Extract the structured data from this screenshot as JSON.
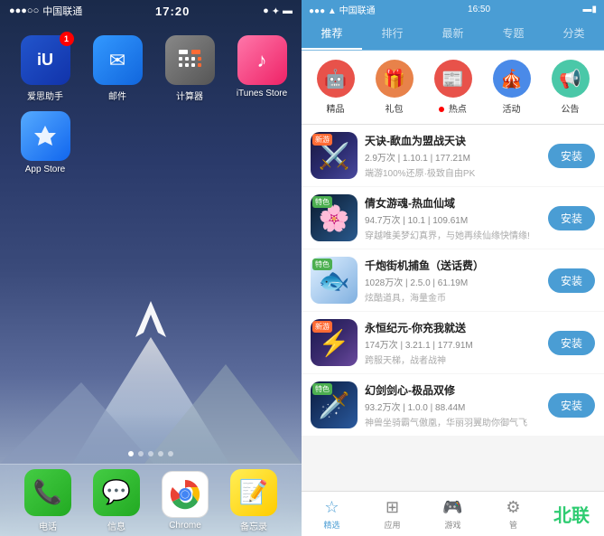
{
  "leftPanel": {
    "statusBar": {
      "carrier": "中国联通",
      "time": "17:20",
      "rightIcons": "● ▲ ✦ 🔋"
    },
    "apps": [
      {
        "id": "aisi",
        "label": "爱思助手",
        "badge": "1",
        "iconClass": "icon-aisi",
        "iconText": "iU"
      },
      {
        "id": "mail",
        "label": "邮件",
        "badge": "",
        "iconClass": "icon-mail",
        "iconText": "✉"
      },
      {
        "id": "calc",
        "label": "计算器",
        "badge": "",
        "iconClass": "icon-calc",
        "iconText": "⊞"
      },
      {
        "id": "itunes",
        "label": "iTunes Store",
        "badge": "",
        "iconClass": "icon-itunes",
        "iconText": "♪"
      },
      {
        "id": "appstore",
        "label": "App Store",
        "badge": "",
        "iconClass": "icon-appstore",
        "iconText": "A"
      }
    ],
    "dock": [
      {
        "id": "phone",
        "label": "电话",
        "iconClass": "icon-phone",
        "iconText": "📞"
      },
      {
        "id": "message",
        "label": "信息",
        "iconClass": "icon-message",
        "iconText": "💬"
      },
      {
        "id": "chrome",
        "label": "Chrome",
        "iconClass": "icon-chrome",
        "iconText": "⊕"
      },
      {
        "id": "notes",
        "label": "备忘录",
        "iconClass": "icon-notes",
        "iconText": "📝"
      }
    ]
  },
  "rightPanel": {
    "statusBar": {
      "carrier": "中国联通",
      "signal": "▲▲▲",
      "time": "16:50",
      "rightIcons": "🔋"
    },
    "tabs": [
      {
        "id": "featured",
        "label": "推荐",
        "active": true
      },
      {
        "id": "ranking",
        "label": "排行",
        "active": false
      },
      {
        "id": "latest",
        "label": "最新",
        "active": false
      },
      {
        "id": "topic",
        "label": "专题",
        "active": false
      },
      {
        "id": "category",
        "label": "分类",
        "active": false
      }
    ],
    "categories": [
      {
        "id": "jingpin",
        "label": "精品",
        "color": "#e8524a",
        "icon": "🤖"
      },
      {
        "id": "libao",
        "label": "礼包",
        "color": "#e8824a",
        "icon": "🎁"
      },
      {
        "id": "redian",
        "label": "热点",
        "color": "#e8524a",
        "icon": "📰",
        "hot": true
      },
      {
        "id": "huodong",
        "label": "活动",
        "color": "#4a8ae8",
        "icon": "🎪"
      },
      {
        "id": "gonggao",
        "label": "公告",
        "color": "#4ac8a8",
        "icon": "📢"
      }
    ],
    "appList": [
      {
        "id": "tianjue",
        "tag": "新游",
        "tagColor": "#ff6b35",
        "name": "天诀-歃血为盟战天诀",
        "meta": "2.9万次  |  1.10.1  |  177.21M",
        "desc": "端游100%还原·极致自由PK",
        "thumbClass": "thumb-tianjue",
        "thumbText": "⚔",
        "installLabel": "安装"
      },
      {
        "id": "qiannv",
        "tag": "特色",
        "tagColor": "#4CAF50",
        "name": "倩女游魂-热血仙域",
        "meta": "94.7万次  |  10.1  |  109.61M",
        "desc": "穿越唯美梦幻真界，与她再续仙缘快情缘!",
        "thumbClass": "thumb-qiannv",
        "thumbText": "🌸",
        "installLabel": "安装"
      },
      {
        "id": "qianbao",
        "tag": "特色",
        "tagColor": "#4CAF50",
        "name": "千炮街机捕鱼（送话费）",
        "meta": "1028万次  |  2.5.0  |  61.19M",
        "desc": "炫酷道具，海量金币",
        "thumbClass": "thumb-qianbao",
        "thumbText": "🐟",
        "installLabel": "安装"
      },
      {
        "id": "yongheng",
        "tag": "新游",
        "tagColor": "#ff6b35",
        "name": "永恒纪元-你充我就送",
        "meta": "174万次  |  3.21.1  |  177.91M",
        "desc": "跨服天梯，战者战神",
        "thumbClass": "thumb-yongheng",
        "thumbText": "⚡",
        "installLabel": "安装"
      },
      {
        "id": "huanjian",
        "tag": "特色",
        "tagColor": "#4CAF50",
        "name": "幻剑剑心-极品双修",
        "meta": "93.2万次  |  1.0.0  |  88.44M",
        "desc": "神兽坐骑霸气傲凰，华丽羽翼助你御气飞",
        "thumbClass": "thumb-huanjian",
        "thumbText": "🗡",
        "installLabel": "安装"
      }
    ],
    "bottomNav": [
      {
        "id": "featured",
        "label": "精选",
        "icon": "☆",
        "active": true
      },
      {
        "id": "apps",
        "label": "应用",
        "icon": "⊞",
        "active": false
      },
      {
        "id": "games",
        "label": "游戏",
        "icon": "🎮",
        "active": false
      },
      {
        "id": "manage",
        "label": "管",
        "icon": "⚙",
        "active": false
      },
      {
        "id": "brand",
        "label": "北联",
        "isBrand": true
      }
    ]
  }
}
